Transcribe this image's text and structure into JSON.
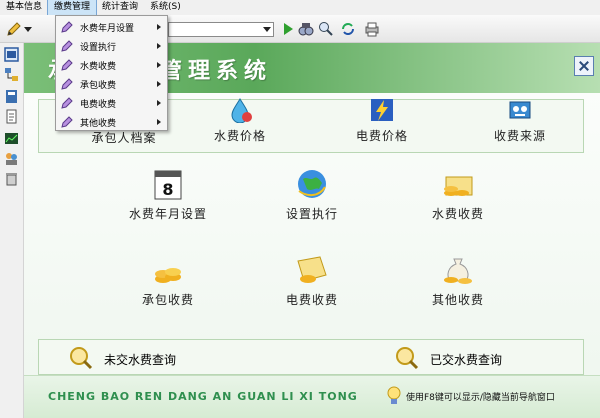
{
  "menubar": {
    "items": [
      "基本信息",
      "缴费管理",
      "统计查询",
      "系统(S)"
    ]
  },
  "toolbar": {
    "icons": [
      "pencil-icon",
      "play-icon",
      "binoculars-icon",
      "search-icon",
      "refresh-icon",
      "print-icon"
    ]
  },
  "dropdown": {
    "items": [
      "水费年月设置",
      "设置执行",
      "水费收费",
      "承包收费",
      "电费收费",
      "其他收费"
    ]
  },
  "banner": {
    "title": "承包档案管理系统"
  },
  "nav": {
    "row1": [
      "承包人档案",
      "水费价格",
      "电费价格",
      "收费来源"
    ],
    "row2": [
      "水费年月设置",
      "设置执行",
      "水费收费"
    ],
    "row3": [
      "承包收费",
      "电费收费",
      "其他收费"
    ],
    "queries": [
      "未交水费查询",
      "已交水费查询"
    ]
  },
  "calendar": {
    "day": "8"
  },
  "footer": {
    "pinyin": "CHENG BAO REN DANG AN GUAN LI XI TONG",
    "tip": "使用F8键可以显示/隐藏当前导航窗口"
  },
  "colors": {
    "banner": "#5aa85a",
    "accent": "#2f8f4f",
    "menu_highlight": "#cce4f7"
  }
}
